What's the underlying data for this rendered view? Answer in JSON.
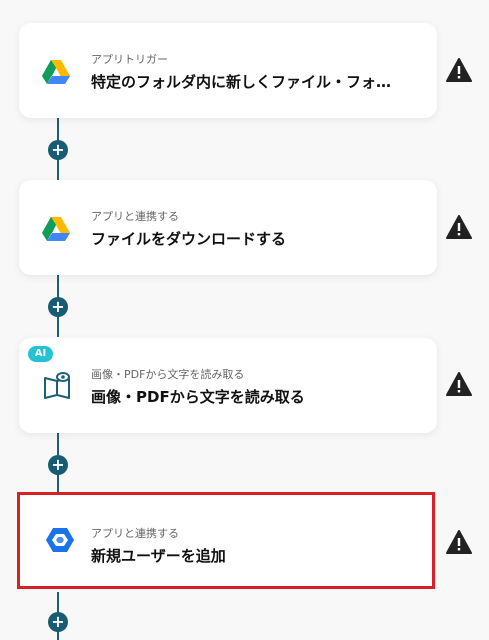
{
  "steps": [
    {
      "subtitle": "アプリトリガー",
      "title": "特定のフォルダ内に新しくファイル・フォ…",
      "icon": "google-drive-icon"
    },
    {
      "subtitle": "アプリと連携する",
      "title": "ファイルをダウンロードする",
      "icon": "google-drive-icon"
    },
    {
      "subtitle": "画像・PDFから文字を読み取る",
      "title": "画像・PDFから文字を読み取る",
      "icon": "ocr-icon",
      "badge": "AI"
    },
    {
      "subtitle": "アプリと連携する",
      "title": "新規ユーザーを追加",
      "icon": "google-workspace-icon"
    }
  ],
  "add_step_symbol": "+",
  "colors": {
    "connector": "#1f5f73",
    "highlight": "#d92027",
    "ai_badge": "#24c2d3"
  }
}
